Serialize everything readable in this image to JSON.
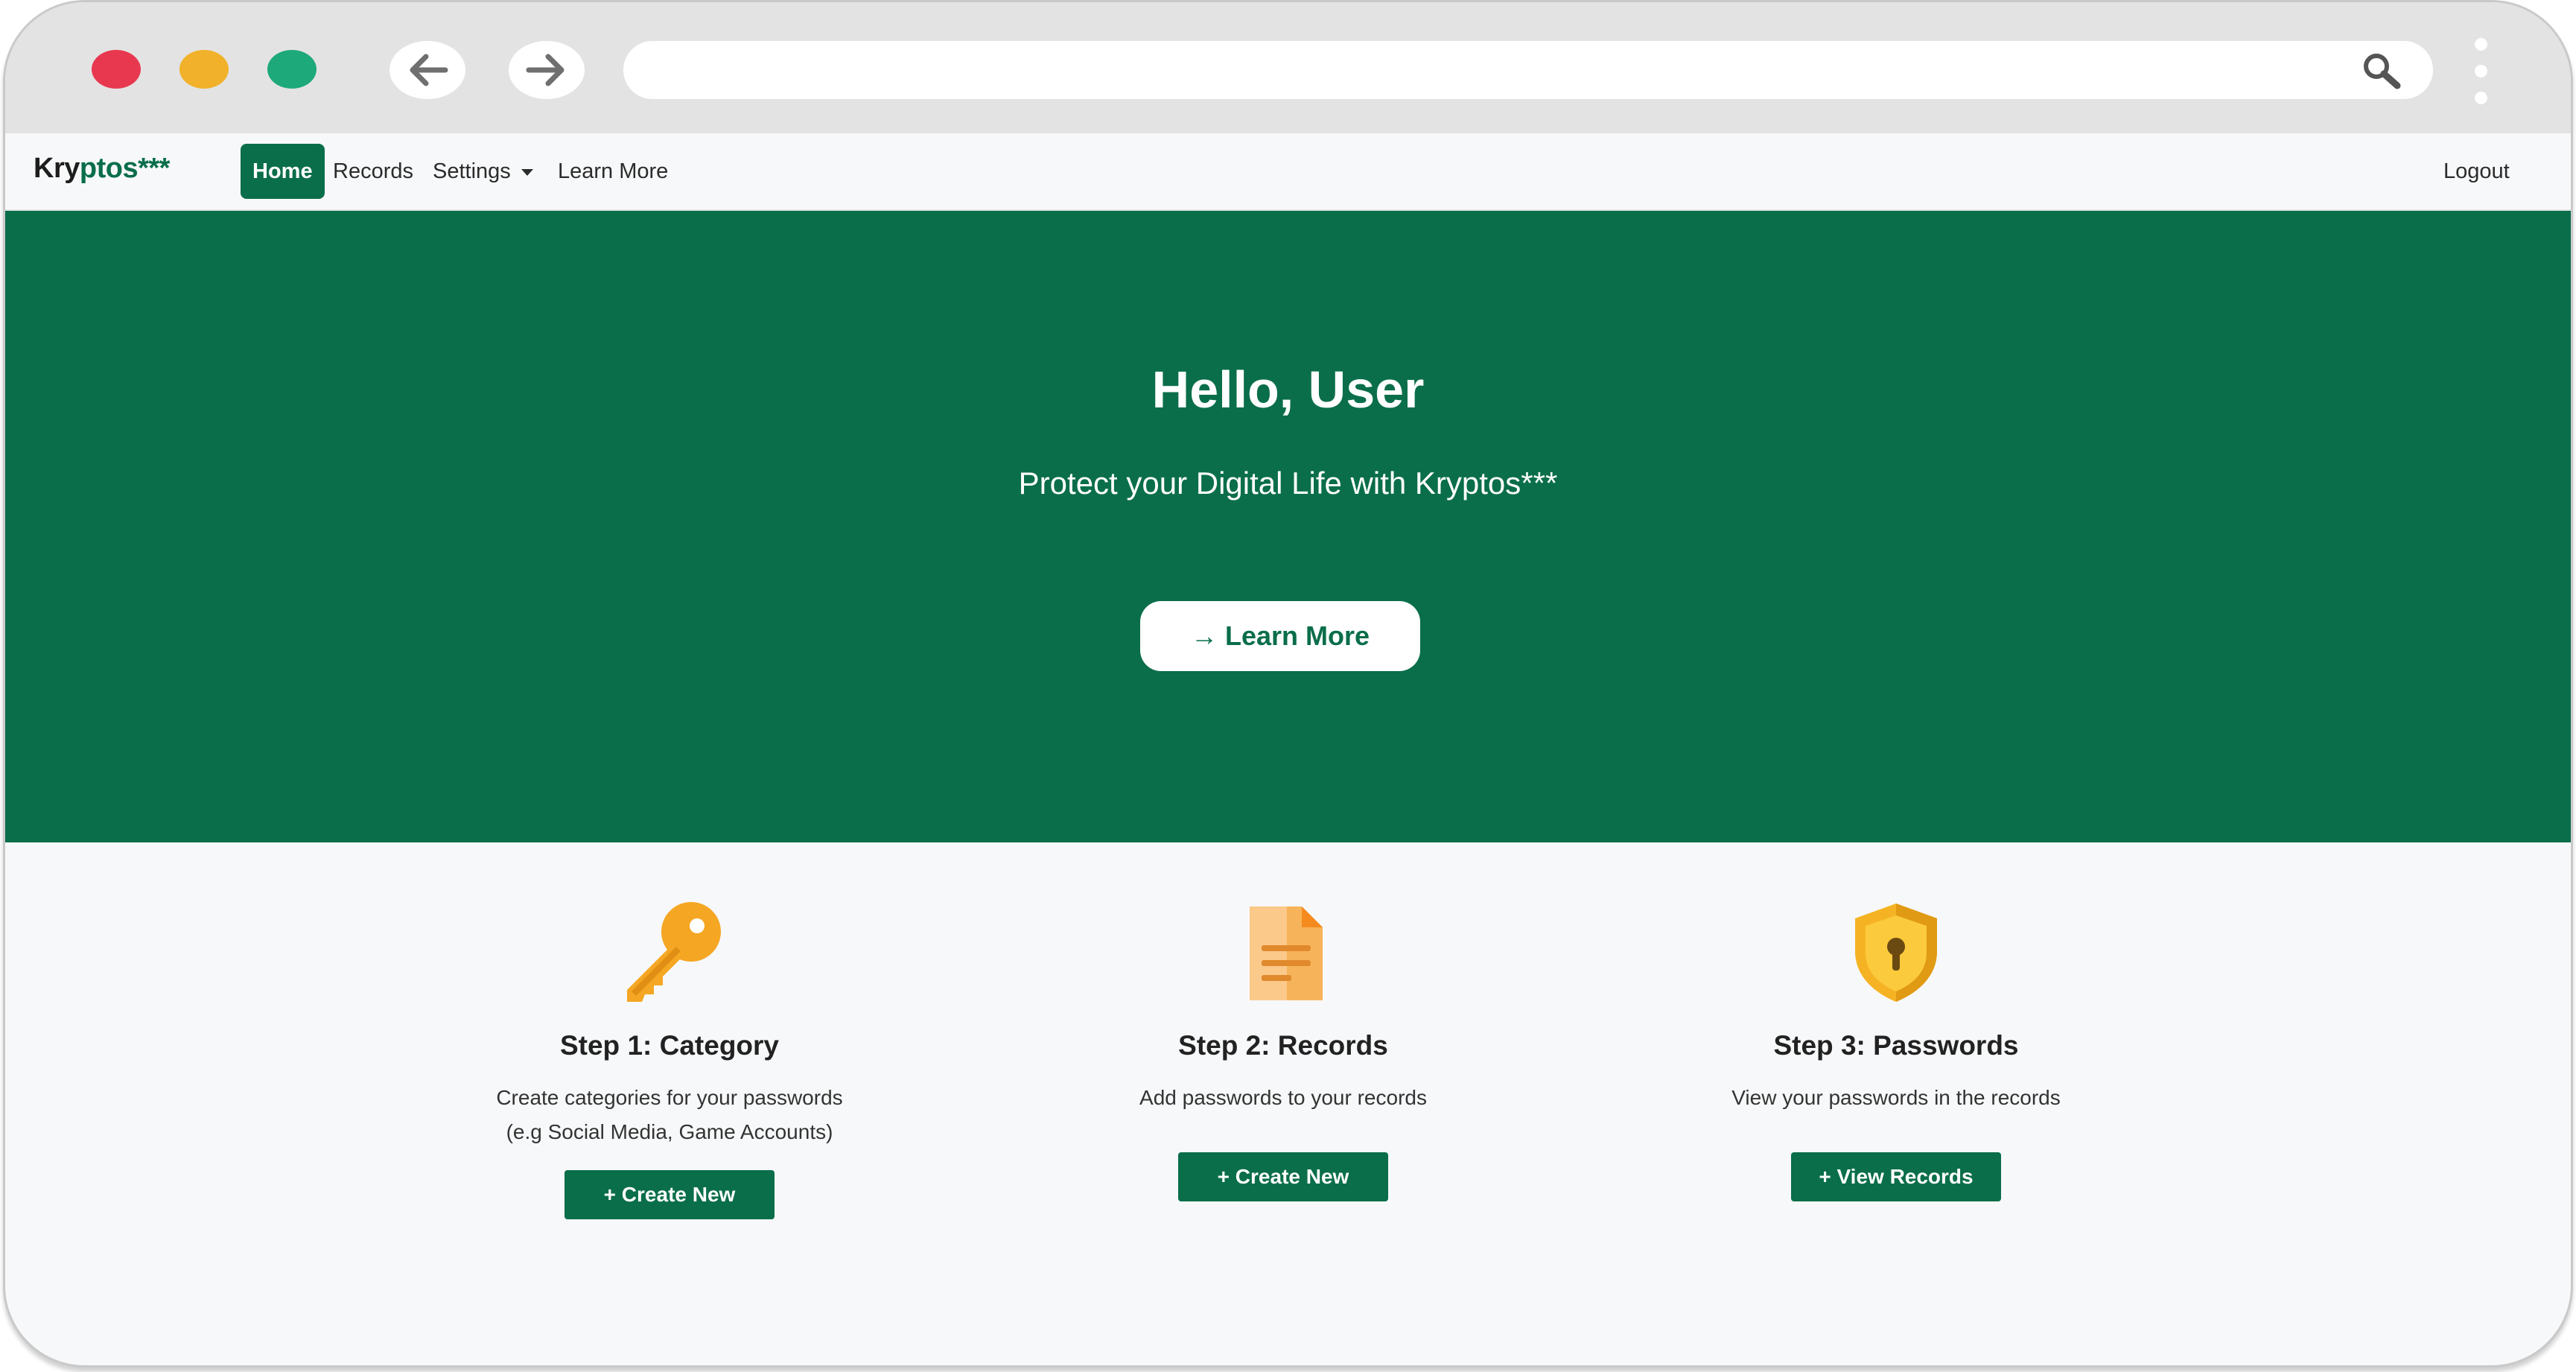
{
  "browser": {
    "url": "",
    "traffic_lights": {
      "red": "#e8384f",
      "yellow": "#f1b12a",
      "green": "#1ea97a"
    }
  },
  "navbar": {
    "brand_part1": "Kry",
    "brand_part2": "ptos***",
    "items": [
      {
        "label": "Home",
        "active": true
      },
      {
        "label": "Records",
        "active": false
      },
      {
        "label": "Settings",
        "active": false,
        "dropdown": true
      },
      {
        "label": "Learn More",
        "active": false
      }
    ],
    "logout_label": "Logout"
  },
  "hero": {
    "title": "Hello, User",
    "subtitle": "Protect your Digital Life with Kryptos***",
    "button_label": "→ Learn More"
  },
  "steps": [
    {
      "icon": "key-icon",
      "title": "Step 1: Category",
      "desc_line1": "Create categories for your passwords",
      "desc_line2": "(e.g Social Media, Game Accounts)",
      "button_label": "+ Create New"
    },
    {
      "icon": "document-icon",
      "title": "Step 2: Records",
      "desc_line1": "Add passwords to your records",
      "button_label": "+ Create New"
    },
    {
      "icon": "shield-icon",
      "title": "Step 3: Passwords",
      "desc_line1": "View your passwords in the records",
      "button_label": "+ View Records"
    }
  ],
  "colors": {
    "primary": "#0a6e4a",
    "background": "#f7f8f9",
    "accent_orange": "#f5a623"
  }
}
